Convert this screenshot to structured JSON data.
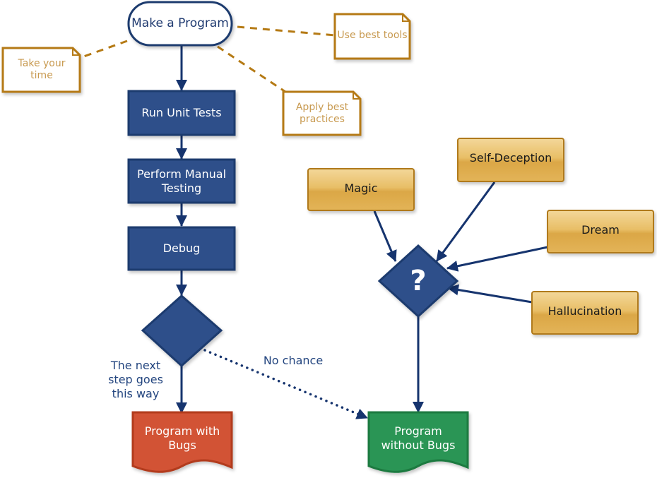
{
  "colors": {
    "primary_blue": "#2e4f8a",
    "border_blue": "#1d3a6e",
    "connector_blue": "#16346e",
    "note_border": "#b57a14",
    "note_text": "#c89a50",
    "gold_fill_top": "#f3d79a",
    "gold_fill_bottom": "#d9a63f",
    "gold_border": "#b07a1a",
    "bugs_red": "#d25234",
    "bugs_red_border": "#b23a1f",
    "no_bugs_green": "#2a9554",
    "no_bugs_green_border": "#1d7a40"
  },
  "nodes": {
    "start": "Make a Program",
    "run_unit_tests": "Run Unit Tests",
    "manual_testing": "Perform Manual Testing",
    "debug": "Debug",
    "decision": "",
    "program_with_bugs": "Program with Bugs",
    "program_without_bugs": "Program without Bugs",
    "question": "?"
  },
  "notes": {
    "take_your_time": "Take your time",
    "use_best_tools": "Use best tools",
    "apply_best_practices": "Apply best practices"
  },
  "sources": {
    "magic": "Magic",
    "self_deception": "Self-Deception",
    "dream": "Dream",
    "hallucination": "Hallucination"
  },
  "annotations": {
    "next_step": "The next step goes this way",
    "no_chance": "No chance"
  },
  "icons": {
    "question_mark": "question-mark-icon"
  }
}
